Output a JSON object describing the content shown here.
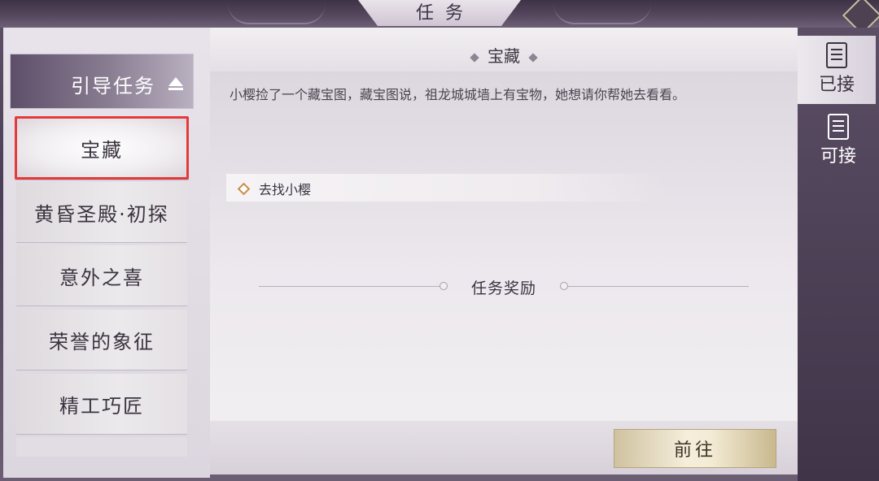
{
  "window": {
    "title": "任务"
  },
  "left_panel": {
    "group_label": "引导任务",
    "items": [
      {
        "label": "宝藏",
        "selected": true
      },
      {
        "label": "黄昏圣殿·初探",
        "selected": false
      },
      {
        "label": "意外之喜",
        "selected": false
      },
      {
        "label": "荣誉的象征",
        "selected": false
      },
      {
        "label": "精工巧匠",
        "selected": false
      }
    ]
  },
  "quest": {
    "title": "宝藏",
    "description": "小樱捡了一个藏宝图，藏宝图说，祖龙城城墙上有宝物，她想请你帮她去看看。",
    "objective": "去找小樱",
    "reward_title": "任务奖励",
    "go_button": "前往"
  },
  "tabs": [
    {
      "label": "已接",
      "icon": "accepted-scroll-icon",
      "active": true
    },
    {
      "label": "可接",
      "icon": "available-scroll-icon",
      "active": false
    }
  ],
  "colors": {
    "selection_outline": "#e53a3a",
    "frame": "#4a3f57",
    "button_gold": "#f3ebd4"
  }
}
